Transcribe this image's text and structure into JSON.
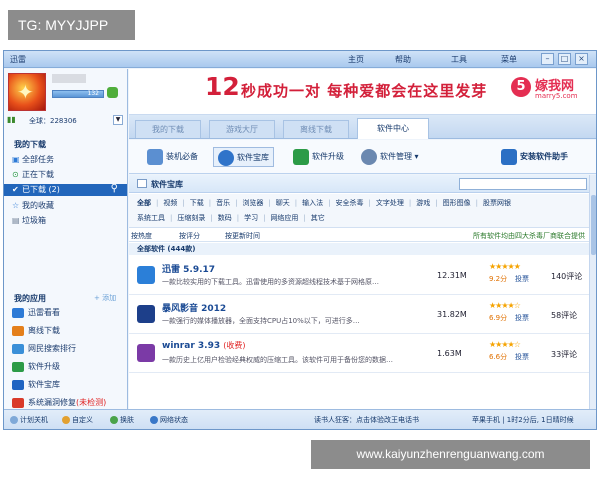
{
  "overlay": {
    "tag": "TG: MYYJJPP",
    "site": "www.kaiyunzhenrenguanwang.com"
  },
  "titlebar": {
    "app_title": "迅雷",
    "menu": [
      "主页",
      "帮助",
      "工具",
      "菜单"
    ]
  },
  "user": {
    "level": "132",
    "total_label": "全球：228306"
  },
  "my_downloads": {
    "title": "我的下载",
    "items": [
      {
        "label": "全部任务",
        "icon": "list-icon"
      },
      {
        "label": "正在下载",
        "icon": "download-icon"
      },
      {
        "label": "已下载",
        "count": "(2)",
        "icon": "check-icon",
        "active": true
      },
      {
        "label": "我的收藏",
        "icon": "star-icon"
      },
      {
        "label": "垃圾箱",
        "icon": "trash-icon"
      }
    ]
  },
  "my_apps": {
    "title": "我的应用",
    "add_label": "+ 添加",
    "items": [
      {
        "label": "迅雷看看",
        "color": "#2d7ad6"
      },
      {
        "label": "离线下载",
        "color": "#e47f1b"
      },
      {
        "label": "网民搜索排行",
        "color": "#3a8fd8"
      },
      {
        "label": "软件升级",
        "color": "#2c9b47"
      },
      {
        "label": "软件宝库",
        "color": "#1f64c2"
      },
      {
        "label": "系统漏洞修复",
        "extra": "(未检测)",
        "color": "#d93a2a"
      }
    ]
  },
  "banner": {
    "big": "12",
    "slogan": "秒成功一对 每种爱都会在这里发芽",
    "logo_mark": "5",
    "logo_name": "嫁我网",
    "logo_url": "marry5.com"
  },
  "tabs": [
    "我的下载",
    "游戏大厅",
    "离线下载",
    "软件中心"
  ],
  "toolbar": {
    "items": [
      "装机必备",
      "软件宝库",
      "软件升级",
      "软件管理"
    ],
    "right": "安装软件助手"
  },
  "content": {
    "header_title": "软件宝库",
    "category_row1": [
      "全部",
      "视频",
      "下载",
      "音乐",
      "浏览器",
      "聊天",
      "输入法",
      "安全杀毒",
      "文字处理",
      "游戏",
      "图形图像",
      "股票网银"
    ],
    "category_row2": [
      "系统工具",
      "压缩刻录",
      "数码",
      "学习",
      "网络应用",
      "其它"
    ],
    "sort": [
      "按热度",
      "按评分",
      "按更新时间"
    ],
    "provider_note": "所有软件均由四大杀毒厂商联合提供",
    "list_title": "全部软件 (444款)",
    "rows": [
      {
        "name": "迅雷 5.9.17",
        "paid": "",
        "desc": "一款比较实用的下载工具。迅雷使用的多资源超线程技术基于网格原…",
        "size": "12.31M",
        "stars": "★★★★★",
        "score": "9.2分",
        "vote": "投票",
        "comments": "140评论",
        "color": "#2b7fd8"
      },
      {
        "name": "暴风影音 2012",
        "paid": "",
        "desc": "一款强行的媒体播放器，全面支持CPU占10%以下，可进行多…",
        "size": "31.82M",
        "stars": "★★★★☆",
        "score": "6.9分",
        "vote": "投票",
        "comments": "58评论",
        "color": "#1d3f8a"
      },
      {
        "name": "winrar 3.93",
        "paid": "(收费)",
        "desc": "一款历史上亿用户检验经典权威的压缩工具。该软件可用于备份您的数据…",
        "size": "1.63M",
        "stars": "★★★★☆",
        "score": "6.6分",
        "vote": "投票",
        "comments": "33评论",
        "color": "#7b3aa6"
      }
    ]
  },
  "statusbar": {
    "left": [
      "计划关机",
      "自定义",
      "换肤",
      "网络状态"
    ],
    "middle": "读书人狂客：点击体验改王电话书",
    "right": "苹果手机 | 1时2分后, 1日晴时候"
  }
}
